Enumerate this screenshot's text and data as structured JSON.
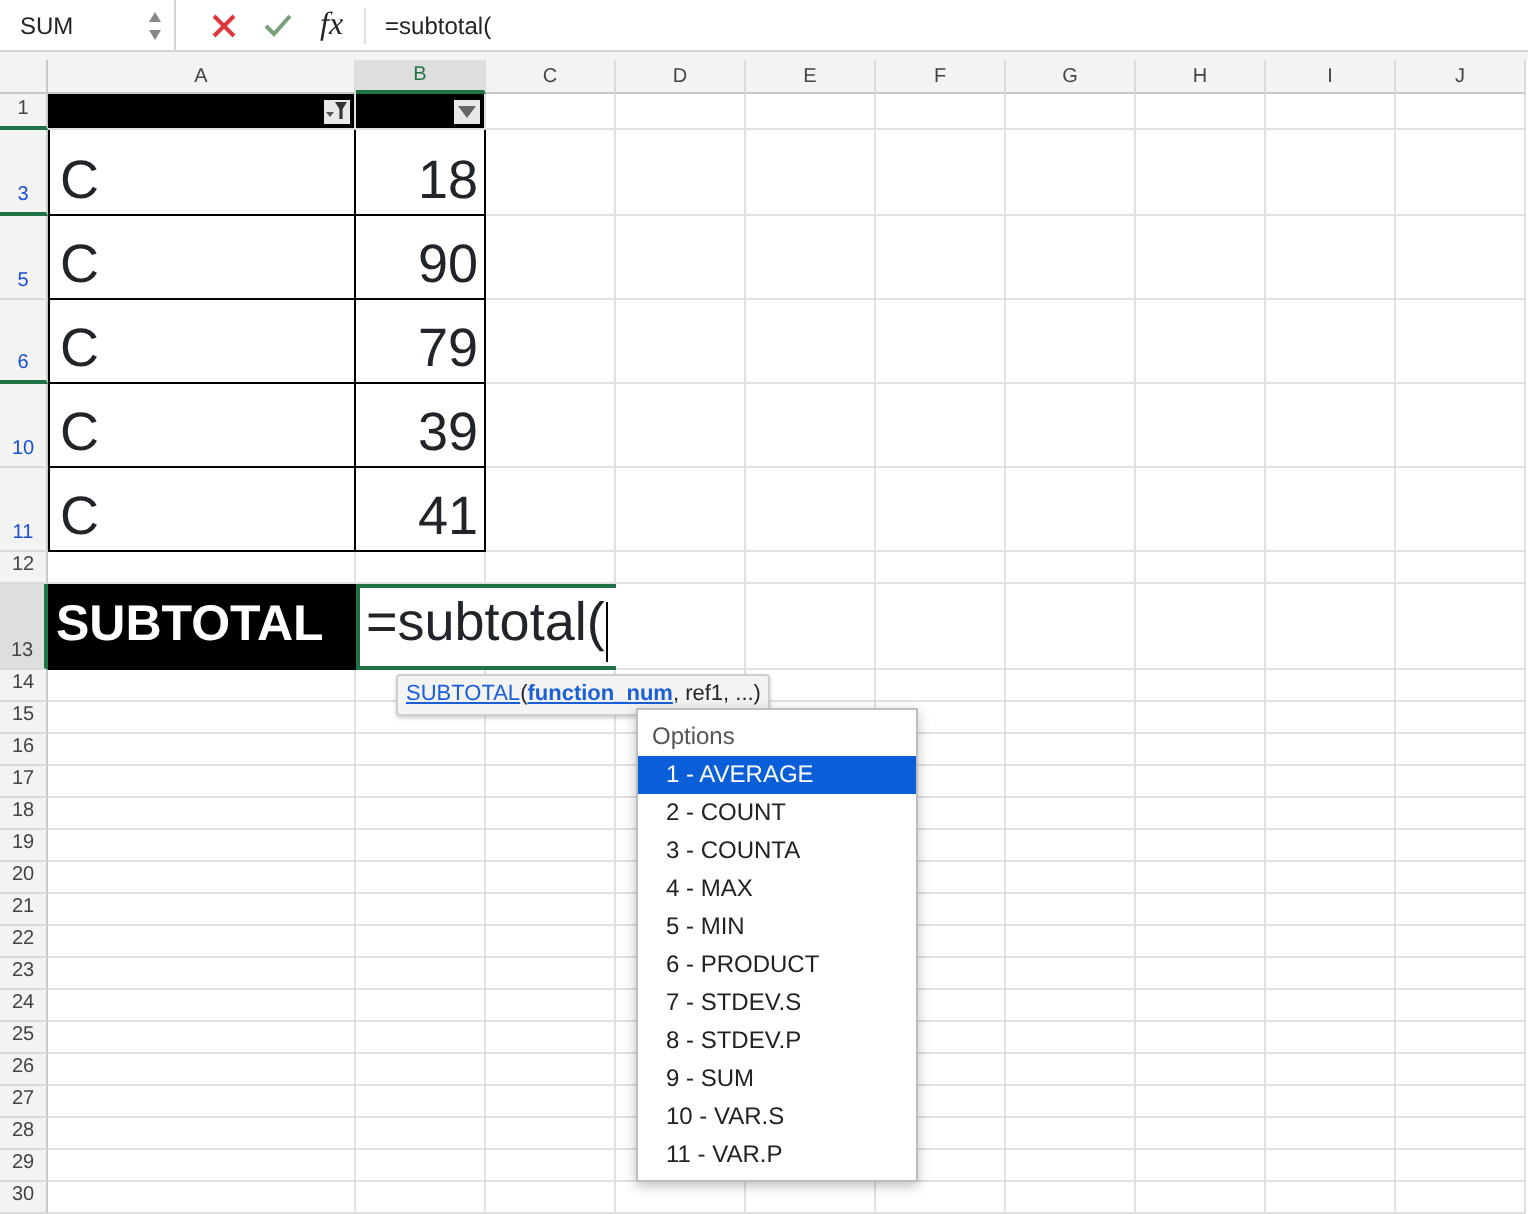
{
  "formula_bar": {
    "name_box": "SUM",
    "fx_label": "fx",
    "formula": "=subtotal("
  },
  "columns": [
    {
      "label": "A",
      "selected": false
    },
    {
      "label": "B",
      "selected": true
    },
    {
      "label": "C",
      "selected": false
    },
    {
      "label": "D",
      "selected": false
    },
    {
      "label": "E",
      "selected": false
    },
    {
      "label": "F",
      "selected": false
    },
    {
      "label": "G",
      "selected": false
    },
    {
      "label": "H",
      "selected": false
    },
    {
      "label": "I",
      "selected": false
    },
    {
      "label": "J",
      "selected": false
    }
  ],
  "rows": [
    {
      "label": "1",
      "filtered": false,
      "selected": false,
      "hidden_after": true,
      "cells": [
        {
          "kind": "header",
          "filtered": true
        },
        {
          "kind": "header",
          "filtered": false
        }
      ]
    },
    {
      "label": "3",
      "filtered": true,
      "selected": false,
      "hidden_after": true,
      "cells": [
        {
          "kind": "text",
          "text": "C"
        },
        {
          "kind": "number",
          "text": "18"
        }
      ]
    },
    {
      "label": "5",
      "filtered": true,
      "selected": false,
      "hidden_after": false,
      "cells": [
        {
          "kind": "text",
          "text": "C"
        },
        {
          "kind": "number",
          "text": "90"
        }
      ]
    },
    {
      "label": "6",
      "filtered": true,
      "selected": false,
      "hidden_after": true,
      "cells": [
        {
          "kind": "text",
          "text": "C"
        },
        {
          "kind": "number",
          "text": "79"
        }
      ]
    },
    {
      "label": "10",
      "filtered": true,
      "selected": false,
      "hidden_after": false,
      "cells": [
        {
          "kind": "text",
          "text": "C"
        },
        {
          "kind": "number",
          "text": "39"
        }
      ]
    },
    {
      "label": "11",
      "filtered": true,
      "selected": false,
      "hidden_after": false,
      "cells": [
        {
          "kind": "text",
          "text": "C"
        },
        {
          "kind": "number",
          "text": "41"
        }
      ]
    },
    {
      "label": "12",
      "filtered": false,
      "selected": false,
      "hidden_after": false
    },
    {
      "label": "13",
      "filtered": false,
      "selected": true,
      "hidden_after": false,
      "cells": [
        {
          "kind": "label",
          "text": "SUBTOTAL"
        },
        {
          "kind": "editing",
          "text": "=subtotal("
        }
      ]
    },
    {
      "label": "14",
      "filtered": false,
      "selected": false,
      "hidden_after": false
    },
    {
      "label": "15",
      "filtered": false,
      "selected": false,
      "hidden_after": false
    },
    {
      "label": "16",
      "filtered": false,
      "selected": false,
      "hidden_after": false
    },
    {
      "label": "17",
      "filtered": false,
      "selected": false,
      "hidden_after": false
    },
    {
      "label": "18",
      "filtered": false,
      "selected": false,
      "hidden_after": false
    },
    {
      "label": "19",
      "filtered": false,
      "selected": false,
      "hidden_after": false
    },
    {
      "label": "20",
      "filtered": false,
      "selected": false,
      "hidden_after": false
    },
    {
      "label": "21",
      "filtered": false,
      "selected": false,
      "hidden_after": false
    },
    {
      "label": "22",
      "filtered": false,
      "selected": false,
      "hidden_after": false
    },
    {
      "label": "23",
      "filtered": false,
      "selected": false,
      "hidden_after": false
    },
    {
      "label": "24",
      "filtered": false,
      "selected": false,
      "hidden_after": false
    },
    {
      "label": "25",
      "filtered": false,
      "selected": false,
      "hidden_after": false
    },
    {
      "label": "26",
      "filtered": false,
      "selected": false,
      "hidden_after": false
    },
    {
      "label": "27",
      "filtered": false,
      "selected": false,
      "hidden_after": false
    },
    {
      "label": "28",
      "filtered": false,
      "selected": false,
      "hidden_after": false
    },
    {
      "label": "29",
      "filtered": false,
      "selected": false,
      "hidden_after": false
    },
    {
      "label": "30",
      "filtered": false,
      "selected": false,
      "hidden_after": false
    }
  ],
  "tooltip": {
    "function_link": "SUBTOTAL",
    "open_paren": "(",
    "current_argument": "function_num",
    "remaining": ", ref1, ...)"
  },
  "options_list": {
    "heading": "Options",
    "items": [
      {
        "label": "1 - AVERAGE",
        "selected": true
      },
      {
        "label": "2 - COUNT",
        "selected": false
      },
      {
        "label": "3 - COUNTA",
        "selected": false
      },
      {
        "label": "4 - MAX",
        "selected": false
      },
      {
        "label": "5 - MIN",
        "selected": false
      },
      {
        "label": "6 - PRODUCT",
        "selected": false
      },
      {
        "label": "7 - STDEV.S",
        "selected": false
      },
      {
        "label": "8 - STDEV.P",
        "selected": false
      },
      {
        "label": "9 - SUM",
        "selected": false
      },
      {
        "label": "10 - VAR.S",
        "selected": false
      },
      {
        "label": "11 - VAR.P",
        "selected": false
      }
    ]
  }
}
